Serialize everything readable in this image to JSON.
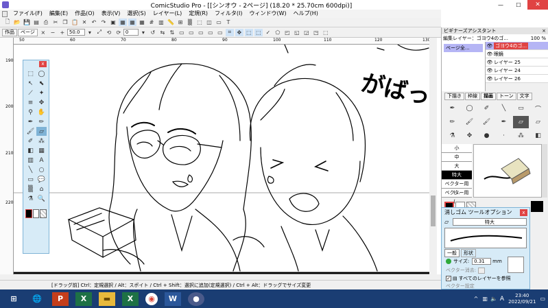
{
  "window": {
    "title": "ComicStudio Pro - [[シンオウ - 2ページ] (18.20 * 25.70cm 600dpi)]",
    "minimize": "—",
    "maximize": "☐",
    "close": "✕"
  },
  "menu": [
    "ファイル(F)",
    "編集(E)",
    "作品(O)",
    "表示(V)",
    "選択(S)",
    "レイヤー(L)",
    "定規(R)",
    "フィルタ(I)",
    "ウィンドウ(W)",
    "ヘルプ(H)"
  ],
  "toolbar2": {
    "tab_work": "作品",
    "tab_page": "ページ",
    "zoom_value": "50.0",
    "rotate_value": "0"
  },
  "ruler": {
    "top_ticks": [
      "50",
      "60",
      "70",
      "80",
      "90",
      "100",
      "110",
      "120",
      "130"
    ],
    "left_ticks": [
      "190",
      "200",
      "210",
      "220"
    ]
  },
  "sfx_text": "がばっ",
  "statusbar": {
    "text": "[ドラッグ前] Ctrl：定規選択 / Alt：スポイト / Ctrl + Shift：選択に追加(定規選択) / Ctrl + Alt：ドラッグでサイズ変更"
  },
  "right_panel": {
    "beginner_title": "ビギナーズアシスタント",
    "edit_layer_label": "編集レイヤー：",
    "edit_layer_value": "ゴヨウ4のゴ...",
    "zoom_percent": "100 %",
    "page_all": "ページ全...",
    "layers": [
      "ゴヨウ4のゴ...",
      "眼鏡",
      "レイヤー 25",
      "レイヤー 24",
      "レイヤー 26"
    ],
    "tabs": [
      "下描き",
      "枠線",
      "描画",
      "トーン",
      "文字"
    ],
    "active_tab": "描画",
    "sizes": [
      "小",
      "中",
      "大",
      "特大",
      "ベクター用(...",
      "ベクター用(..."
    ],
    "active_size": "特大"
  },
  "eraser_dialog": {
    "title": "消しゴム ツールオプション",
    "close": "x",
    "size_preset": "特大",
    "tab_general": "一般",
    "tab_shape": "形状",
    "size_label": "サイズ:",
    "size_value": "0.31",
    "size_unit": "mm",
    "vector_erase_label": "ベクター消去:",
    "all_layers_label": "すべてのレイヤーを参照",
    "advanced_label": "ベクター設定"
  },
  "toolpanel": {
    "close": "x"
  },
  "taskbar": {
    "time": "23:40",
    "date": "2022/09/21",
    "ime": "A",
    "apps": [
      "P",
      "X",
      "X",
      "W"
    ]
  },
  "colors": {
    "accent": "#1a3d73",
    "panel_blue": "#d7ebf7",
    "selected_layer": "#b5b5f5",
    "close_red": "#e04343"
  }
}
